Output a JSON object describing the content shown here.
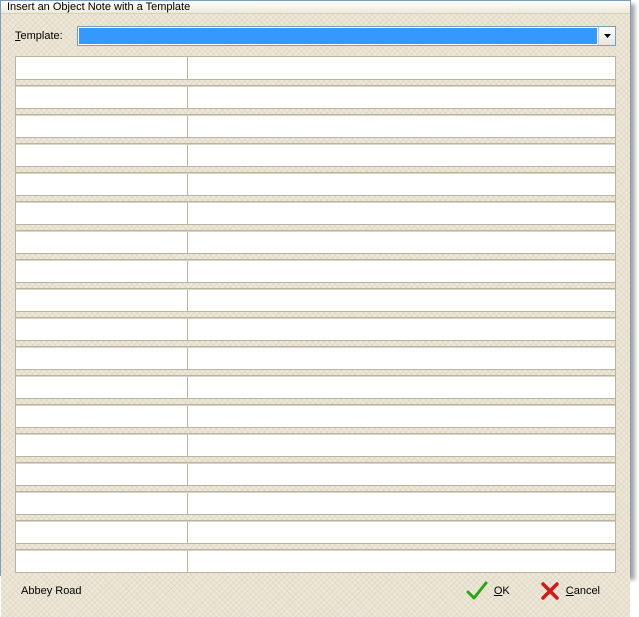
{
  "title": "Insert an Object Note with a Template",
  "template": {
    "label_prefix": "T",
    "label_rest": "emplate:",
    "selected": "",
    "options": []
  },
  "grid": {
    "row_count": 18,
    "columns": [
      "",
      ""
    ]
  },
  "footer": {
    "status": "Abbey Road",
    "ok_prefix": "O",
    "ok_rest": "K",
    "cancel_prefix": "C",
    "cancel_rest": "ancel"
  },
  "colors": {
    "highlight": "#3399ff",
    "ok_icon": "#2aa515",
    "cancel_icon": "#d21a1a"
  }
}
